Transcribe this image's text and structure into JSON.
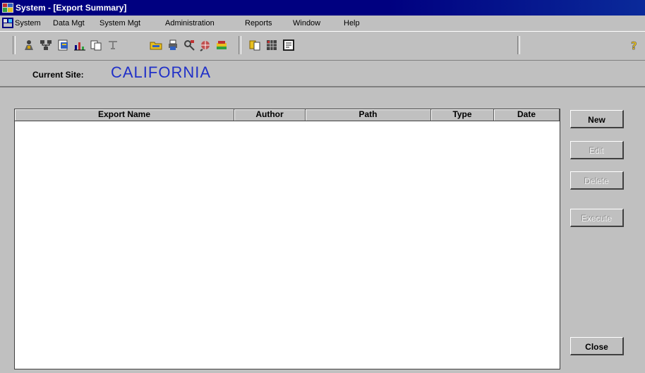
{
  "window": {
    "title": "System - [Export Summary]"
  },
  "menu": {
    "items": [
      {
        "label": "System"
      },
      {
        "label": "Data Mgt"
      },
      {
        "label": "System Mgt"
      },
      {
        "label": "Administration"
      },
      {
        "label": "Reports"
      },
      {
        "label": "Window"
      },
      {
        "label": "Help"
      }
    ]
  },
  "toolbar": {
    "icons": [
      "user-icon",
      "network-icon",
      "report-icon",
      "chart-icon",
      "copy-icon",
      "pin-icon",
      "folder-icon",
      "printer-icon",
      "find-icon",
      "globe-icon",
      "file-icon",
      "document-icon",
      "grid-icon",
      "form-icon",
      "help-icon"
    ]
  },
  "site": {
    "label": "Current Site:",
    "value": "CALIFORNIA"
  },
  "grid": {
    "columns": [
      {
        "label": "Export Name"
      },
      {
        "label": "Author"
      },
      {
        "label": "Path"
      },
      {
        "label": "Type"
      },
      {
        "label": "Date"
      }
    ],
    "rows": []
  },
  "buttons": {
    "new": "New",
    "edit": "Edit",
    "delete": "Delete",
    "execute": "Execute",
    "close": "Close"
  },
  "colors": {
    "title_bar": "#000080",
    "site_value": "#2030c8",
    "window_bg": "#c0c0c0"
  }
}
